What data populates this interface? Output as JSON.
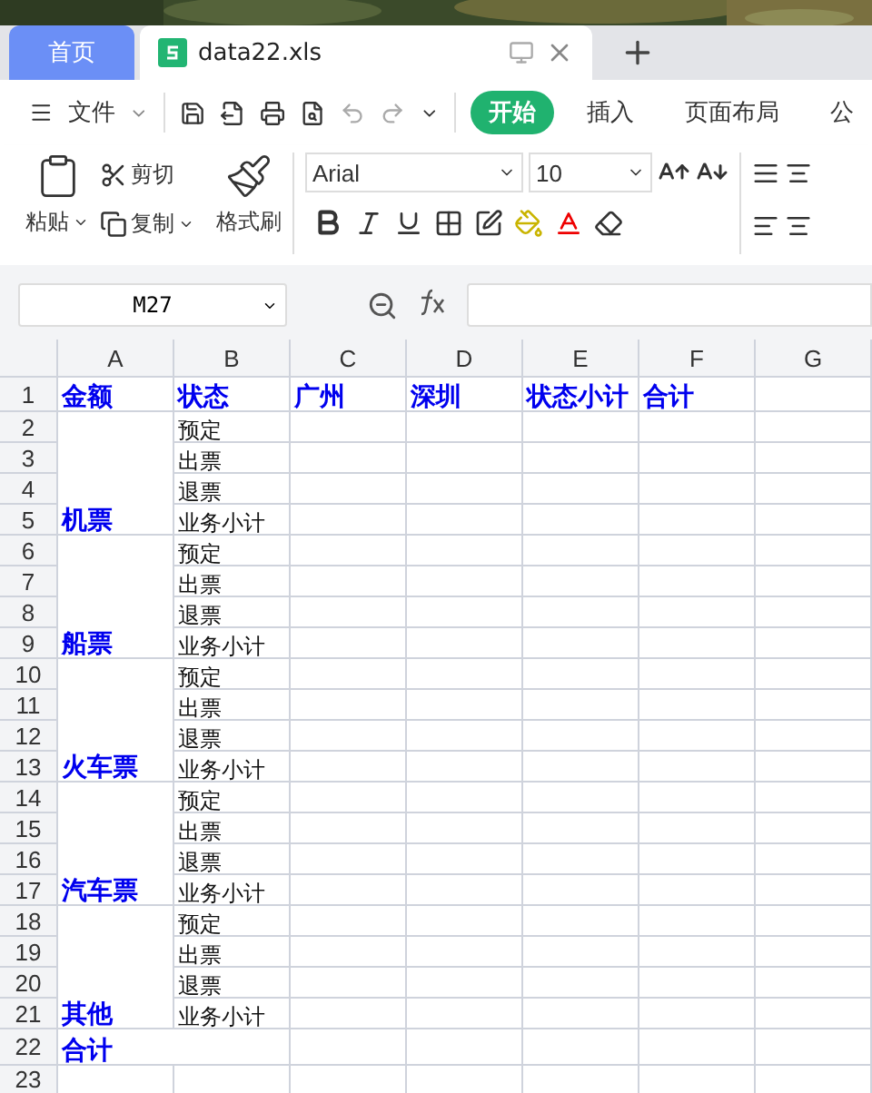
{
  "tabs": [
    {
      "kind": "home",
      "label": "首页",
      "selected": false
    },
    {
      "kind": "file",
      "label": "data22.xls",
      "selected": true
    }
  ],
  "menu": {
    "file": "文件",
    "ribbon_tabs": [
      {
        "label": "开始",
        "selected": true
      },
      {
        "label": "插入",
        "selected": false
      },
      {
        "label": "页面布局",
        "selected": false
      },
      {
        "label": "公",
        "selected": false
      }
    ]
  },
  "ribbon": {
    "paste": "粘贴",
    "cut": "剪切",
    "copy": "复制",
    "format_painter": "格式刷",
    "font": "Arial",
    "size": "10"
  },
  "name_box": "M27",
  "sheet": {
    "columns": [
      "A",
      "B",
      "C",
      "D",
      "E",
      "F",
      "G"
    ],
    "header_row": {
      "number": "1",
      "cells": [
        "金额",
        "状态",
        "广州",
        "深圳",
        "状态小计",
        "合计"
      ]
    },
    "groups": [
      {
        "label": "机票",
        "rows": [
          {
            "number": "2",
            "status": "预定"
          },
          {
            "number": "3",
            "status": "出票"
          },
          {
            "number": "4",
            "status": "退票"
          },
          {
            "number": "5",
            "status": "业务小计"
          }
        ]
      },
      {
        "label": "船票",
        "rows": [
          {
            "number": "6",
            "status": "预定"
          },
          {
            "number": "7",
            "status": "出票"
          },
          {
            "number": "8",
            "status": "退票"
          },
          {
            "number": "9",
            "status": "业务小计"
          }
        ]
      },
      {
        "label": "火车票",
        "rows": [
          {
            "number": "10",
            "status": "预定"
          },
          {
            "number": "11",
            "status": "出票"
          },
          {
            "number": "12",
            "status": "退票"
          },
          {
            "number": "13",
            "status": "业务小计"
          }
        ]
      },
      {
        "label": "汽车票",
        "rows": [
          {
            "number": "14",
            "status": "预定"
          },
          {
            "number": "15",
            "status": "出票"
          },
          {
            "number": "16",
            "status": "退票"
          },
          {
            "number": "17",
            "status": "业务小计"
          }
        ]
      },
      {
        "label": "其他",
        "rows": [
          {
            "number": "18",
            "status": "预定"
          },
          {
            "number": "19",
            "status": "出票"
          },
          {
            "number": "20",
            "status": "退票"
          },
          {
            "number": "21",
            "status": "业务小计"
          }
        ]
      }
    ],
    "total_row": {
      "number": "22",
      "label": "合计"
    },
    "empty_rows": [
      {
        "number": "23"
      }
    ]
  }
}
